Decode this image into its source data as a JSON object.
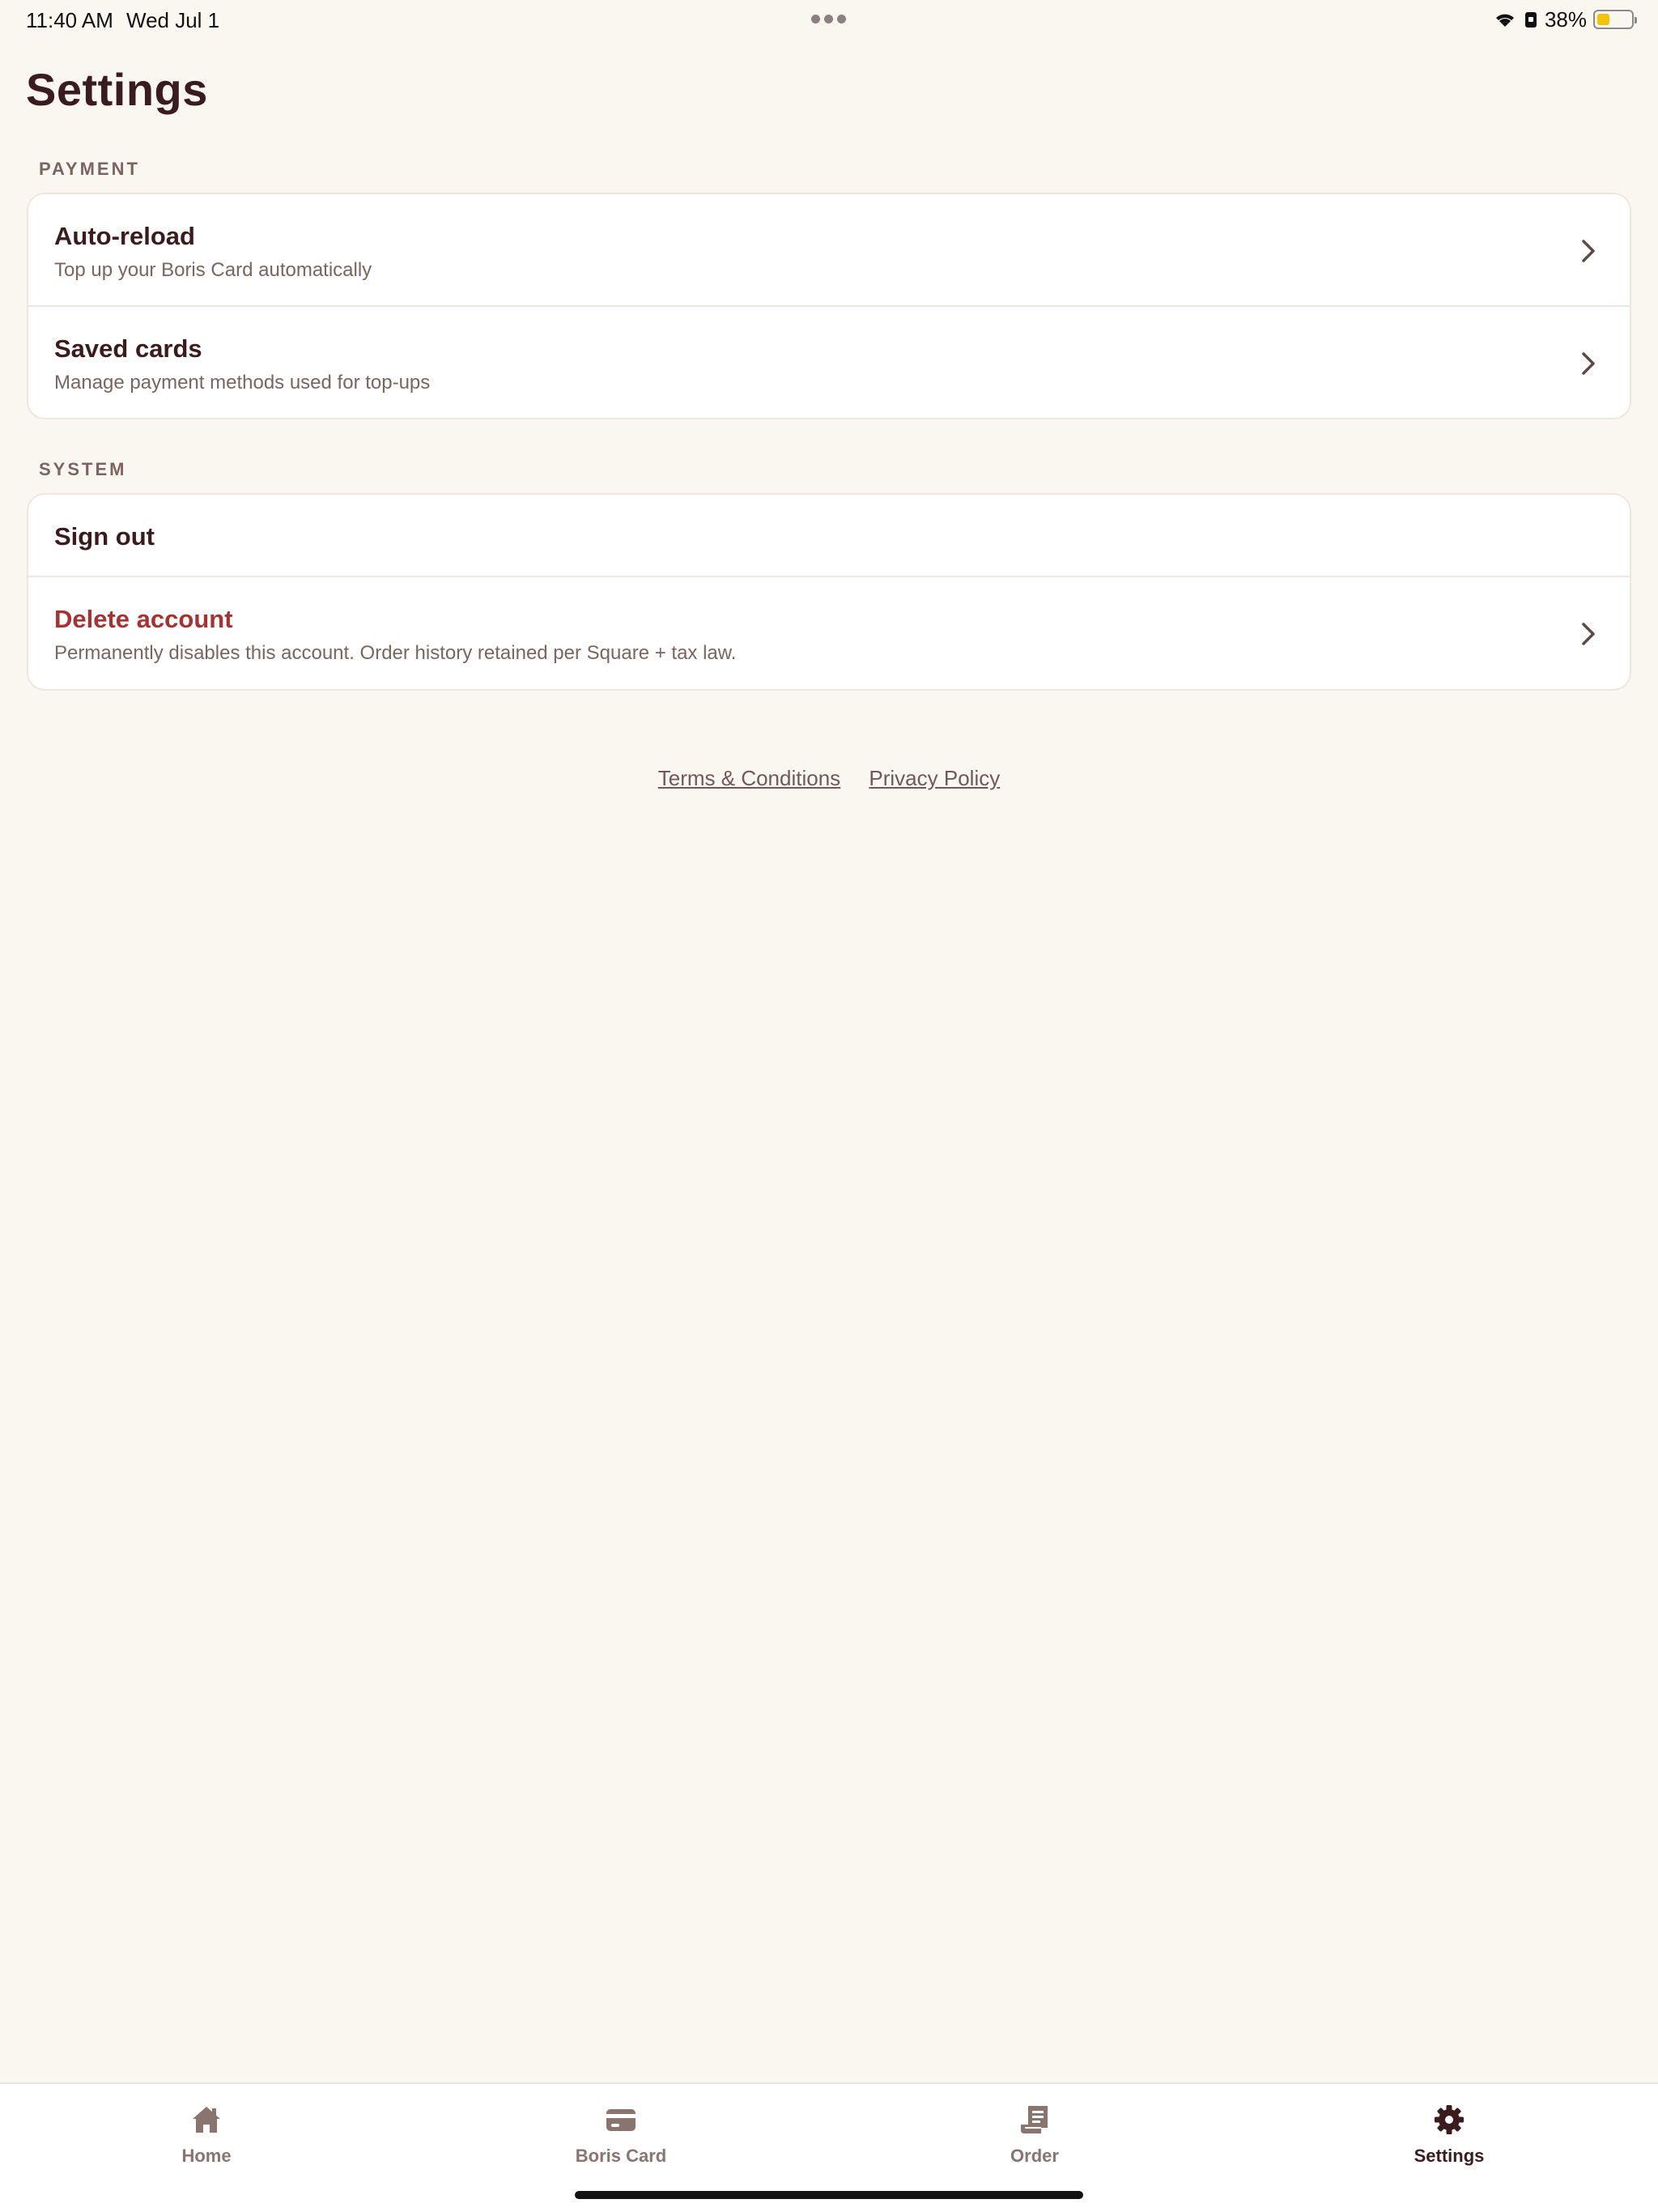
{
  "status_bar": {
    "time": "11:40 AM",
    "date": "Wed Jul 1",
    "battery_text": "38%",
    "battery_level": 0.38,
    "battery_color": "#f5c400"
  },
  "page": {
    "title": "Settings"
  },
  "sections": {
    "payment": {
      "label": "PAYMENT",
      "items": [
        {
          "title": "Auto-reload",
          "subtitle": "Top up your Boris Card automatically"
        },
        {
          "title": "Saved cards",
          "subtitle": "Manage payment methods used for top-ups"
        }
      ]
    },
    "system": {
      "label": "SYSTEM",
      "items": [
        {
          "title": "Sign out"
        },
        {
          "title": "Delete account",
          "subtitle": "Permanently disables this account. Order history retained per Square + tax law."
        }
      ]
    }
  },
  "links": {
    "terms": "Terms & Conditions",
    "privacy": "Privacy Policy"
  },
  "tabbar": {
    "tabs": [
      {
        "label": "Home",
        "icon": "home-icon"
      },
      {
        "label": "Boris Card",
        "icon": "card-icon"
      },
      {
        "label": "Order",
        "icon": "receipt-icon"
      },
      {
        "label": "Settings",
        "icon": "gear-icon",
        "active": true
      }
    ]
  },
  "colors": {
    "background": "#faf6f0",
    "primary_text": "#3a1c1e",
    "secondary_text": "#7a6560",
    "danger": "#a83232"
  }
}
